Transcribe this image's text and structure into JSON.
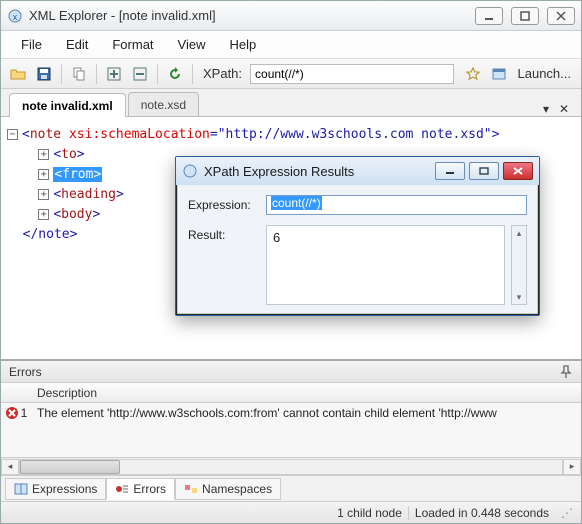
{
  "window": {
    "title": "XML Explorer - [note invalid.xml]"
  },
  "menu": {
    "items": [
      "File",
      "Edit",
      "Format",
      "View",
      "Help"
    ]
  },
  "toolbar": {
    "xpath_label": "XPath:",
    "xpath_value": "count(//*)",
    "launch_label": "Launch..."
  },
  "tabs": [
    {
      "label": "note invalid.xml",
      "active": true
    },
    {
      "label": "note.xsd",
      "active": false
    }
  ],
  "xml": {
    "root_open": "<note",
    "root_attr_name": "xsi:schemaLocation",
    "root_attr_value": "\"http://www.w3schools.com note.xsd\"",
    "root_close_frag": ">",
    "children": [
      {
        "tag": "to"
      },
      {
        "tag": "from",
        "selected": true
      },
      {
        "tag": "heading"
      },
      {
        "tag": "body"
      }
    ],
    "root_end": "</note>"
  },
  "dialog": {
    "title": "XPath Expression Results",
    "expr_label": "Expression:",
    "expr_value": "count(//*)",
    "result_label": "Result:",
    "result_value": "6"
  },
  "errors": {
    "title": "Errors",
    "col_desc": "Description",
    "rows": [
      {
        "num": "1",
        "text": "The element 'http://www.w3schools.com:from' cannot contain child element 'http://www"
      }
    ]
  },
  "bottom_tabs": {
    "expressions": "Expressions",
    "errors": "Errors",
    "namespaces": "Namespaces"
  },
  "status": {
    "nodes": "1 child node",
    "loaded": "Loaded in 0.448 seconds"
  }
}
